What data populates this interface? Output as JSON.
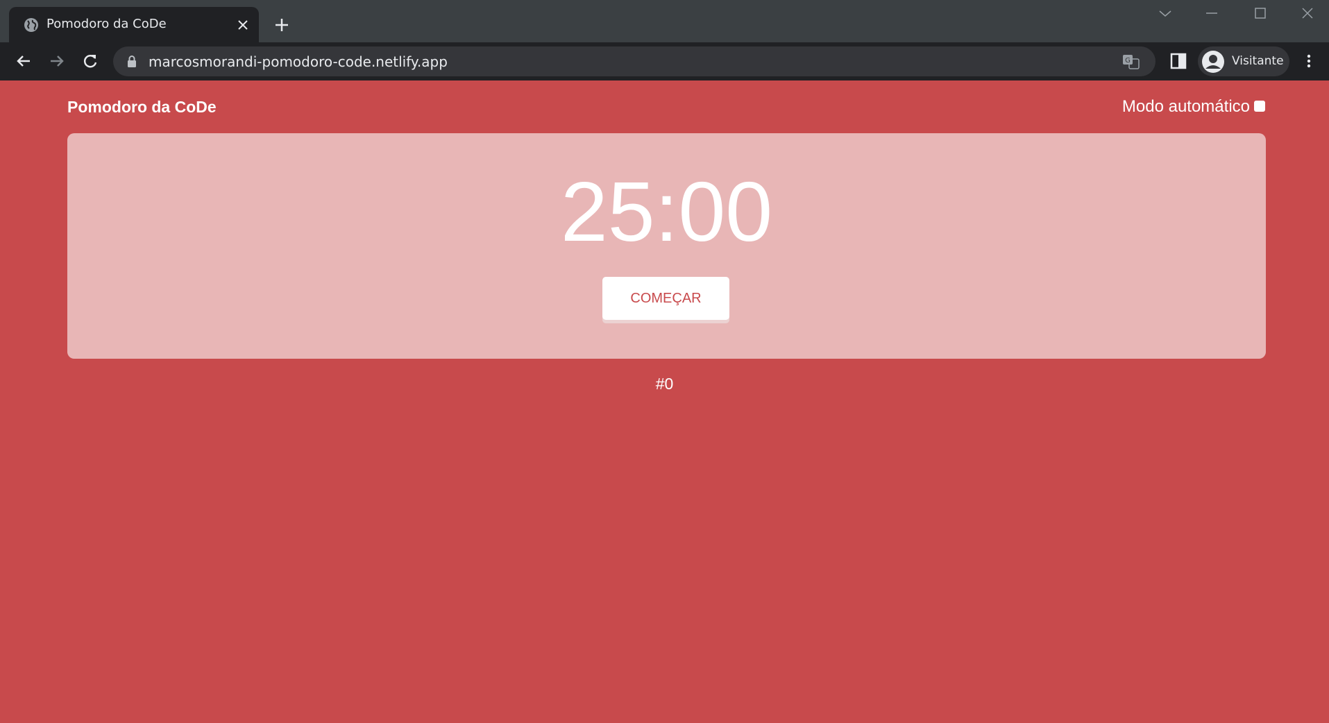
{
  "browser": {
    "tab_title": "Pomodoro da CoDe",
    "url": "marcosmorandi-pomodoro-code.netlify.app",
    "profile_name": "Visitante",
    "icons": {
      "favicon": "globe-icon",
      "close": "close-icon",
      "new_tab": "plus-icon",
      "back": "arrow-left-icon",
      "forward": "arrow-right-icon",
      "reload": "reload-icon",
      "lock": "lock-icon",
      "translate": "translate-icon",
      "side_panel": "side-panel-icon",
      "profile": "avatar-icon",
      "menu": "kebab-menu-icon"
    }
  },
  "app": {
    "title": "Pomodoro da CoDe",
    "auto_mode_label": "Modo automático",
    "auto_mode_checked": false,
    "timer": "25:00",
    "start_label": "COMEÇAR",
    "cycle_count": "#0"
  },
  "colors": {
    "background": "#c84a4c",
    "card": "#e8b6b6",
    "button_text": "#c84a4c",
    "chrome_dark": "#202124",
    "chrome_tabbar": "#3b4043"
  }
}
